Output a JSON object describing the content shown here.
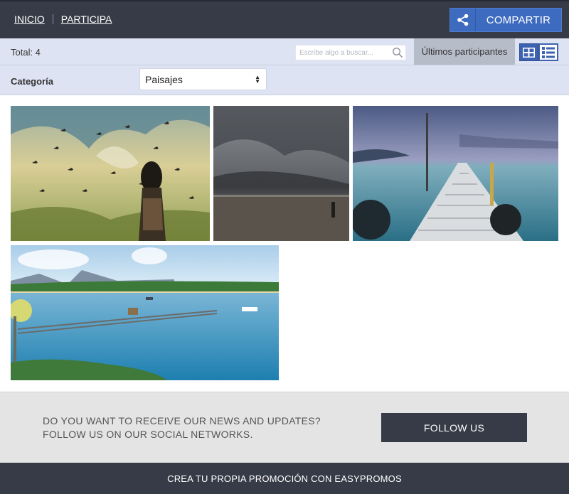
{
  "nav": {
    "items": [
      {
        "label": "INICIO"
      },
      {
        "label": "PARTICIPA"
      }
    ],
    "share_label": "COMPARTIR"
  },
  "toolbar": {
    "total": "Total: 4",
    "search_placeholder": "Escribe algo a buscar...",
    "latest_label": "Últimos participantes"
  },
  "filter": {
    "category_label": "Categoría",
    "selected": "Paisajes"
  },
  "gallery": {
    "count": 4
  },
  "newsletter": {
    "line1": "DO YOU WANT TO RECEIVE OUR NEWS AND UPDATES?",
    "line2": "FOLLOW US ON OUR SOCIAL NETWORKS.",
    "button": "FOLLOW US"
  },
  "footer": {
    "text": "CREA TU PROPIA PROMOCIÓN CON EASYPROMOS"
  },
  "colors": {
    "dark_bar": "#373b47",
    "accent_blue": "#3d6bbf",
    "toolbar_bg": "#dde3f2"
  }
}
